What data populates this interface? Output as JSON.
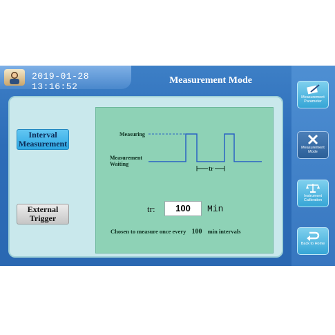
{
  "header": {
    "datetime": "2019-01-28 13:16:52",
    "title": "Measurement Mode"
  },
  "modes": {
    "interval": "Interval Measurement",
    "external": "External Trigger"
  },
  "diagram": {
    "measuring_label": "Measuring",
    "waiting_label": "Measurement Waiting",
    "tr_marker": "tr"
  },
  "interval_setting": {
    "label": "tr:",
    "value": "100",
    "unit": "Min"
  },
  "footer": {
    "prefix": "Chosen to measure once every",
    "value": "100",
    "suffix": "min intervals"
  },
  "sidebar": {
    "items": [
      {
        "label": "Measurement Parameter",
        "icon": "document-pencil-icon"
      },
      {
        "label": "Measurement Mode",
        "icon": "wrench-cross-icon"
      },
      {
        "label": "Instrument Calibration",
        "icon": "balance-scale-icon"
      },
      {
        "label": "Back to Home",
        "icon": "return-arrow-icon"
      }
    ]
  },
  "colors": {
    "screen_blue": "#2d6db8",
    "panel": "#c9e8ec",
    "diagram_green": "#8ed2b6",
    "active_mode": "#2ea7e3",
    "signal_line": "#2a63c4"
  }
}
